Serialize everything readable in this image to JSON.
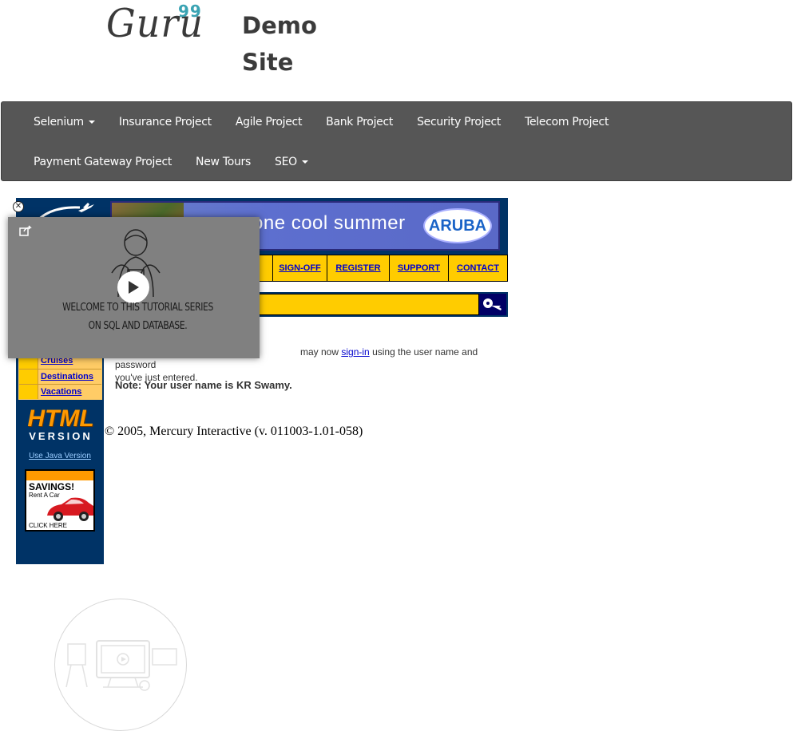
{
  "header": {
    "logo_text": "Guru",
    "logo_superscript": "99",
    "site_title": "Demo Site"
  },
  "navbar": {
    "row1": [
      "Selenium",
      "Insurance Project",
      "Agile Project",
      "Bank Project",
      "Security Project",
      "Telecom Project"
    ],
    "row2": [
      "Payment Gateway Project",
      "New Tours",
      "SEO"
    ]
  },
  "tours": {
    "banner_text": "one cool summer",
    "banner_brand": "ARUBA",
    "menu": [
      "SIGN-OFF",
      "REGISTER",
      "SUPPORT",
      "CONTACT"
    ],
    "side_links": [
      "Cruises",
      "Destinations",
      "Vacations"
    ],
    "html_version_top": "HTML",
    "html_version_bottom": "VERSION",
    "java_link": "Use Java Version",
    "ad": {
      "title": "SAVINGS!",
      "subtitle": "Rent A Car",
      "cta": "CLICK HERE"
    }
  },
  "content": {
    "registration_pre": "may now",
    "registration_link": "sign-in",
    "registration_post": "using the user name and password",
    "registration_line2": "you've just entered.",
    "note": "Note: Your user name is KR Swamy.",
    "copyright": "© 2005, Mercury Interactive (v. 011003-1.01-058)"
  },
  "video_popup": {
    "caption_line1": "WELCOME TO THIS TUTORIAL SERIES",
    "caption_line2": "ON SQL AND DATABASE.",
    "close_icon": "close-icon",
    "share_icon": "share-icon",
    "play_icon": "play-icon"
  }
}
